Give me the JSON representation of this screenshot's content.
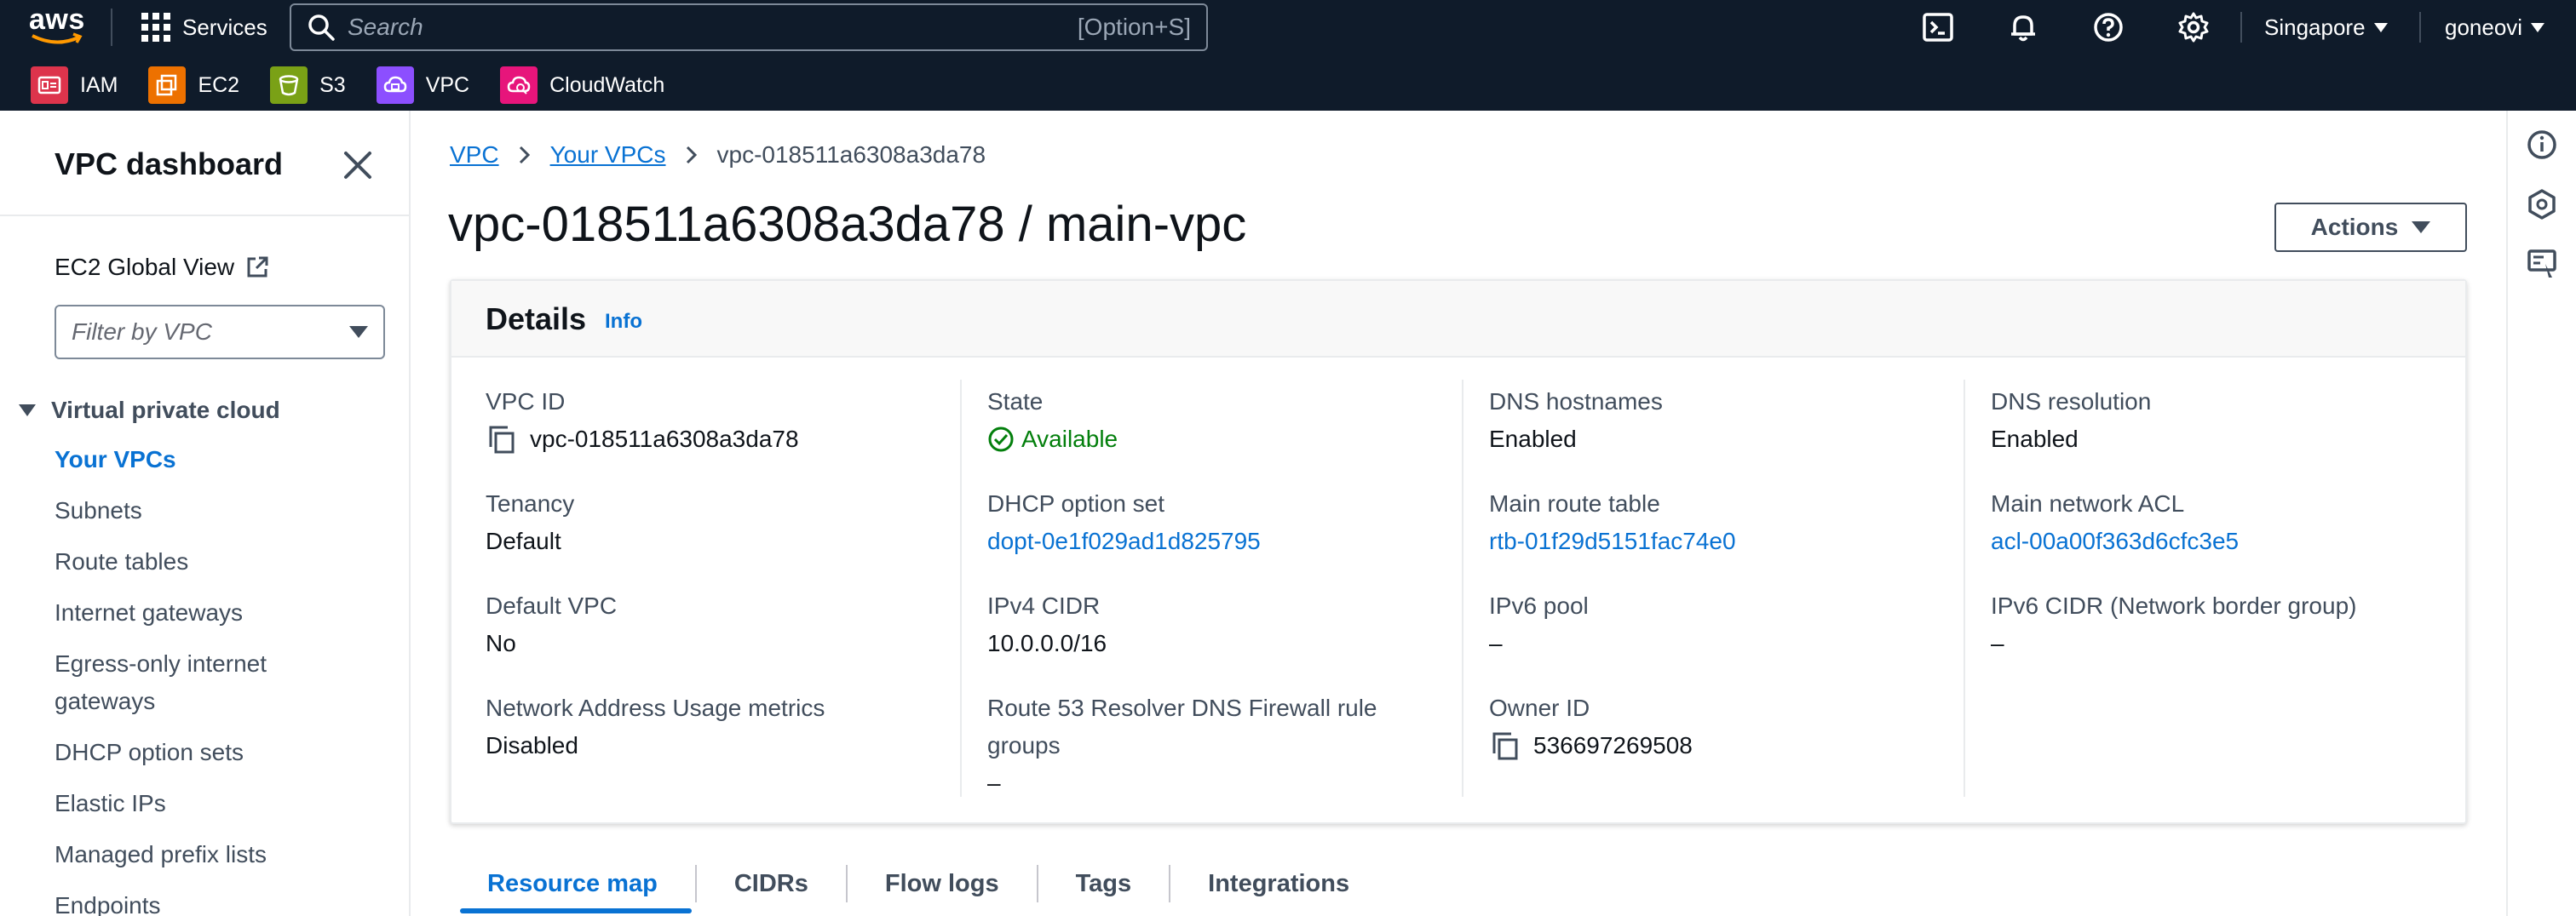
{
  "topnav": {
    "logo_text": "aws",
    "services_label": "Services",
    "search_placeholder": "Search",
    "search_shortcut": "[Option+S]",
    "region": "Singapore",
    "user": "goneovi"
  },
  "favorites": [
    {
      "label": "IAM",
      "color": "#dd344c"
    },
    {
      "label": "EC2",
      "color": "#ed7100"
    },
    {
      "label": "S3",
      "color": "#7aa116"
    },
    {
      "label": "VPC",
      "color": "#8c4fff"
    },
    {
      "label": "CloudWatch",
      "color": "#e7157b"
    }
  ],
  "sidebar": {
    "title": "VPC dashboard",
    "ec2_global_view": "EC2 Global View",
    "filter_placeholder": "Filter by VPC",
    "section": "Virtual private cloud",
    "items": [
      {
        "label": "Your VPCs",
        "active": true
      },
      {
        "label": "Subnets"
      },
      {
        "label": "Route tables"
      },
      {
        "label": "Internet gateways"
      },
      {
        "label": "Egress-only internet gateways"
      },
      {
        "label": "DHCP option sets"
      },
      {
        "label": "Elastic IPs"
      },
      {
        "label": "Managed prefix lists"
      },
      {
        "label": "Endpoints"
      }
    ]
  },
  "breadcrumb": {
    "items": [
      "VPC",
      "Your VPCs"
    ],
    "current": "vpc-018511a6308a3da78"
  },
  "page": {
    "title": "vpc-018511a6308a3da78 / main-vpc",
    "actions_label": "Actions"
  },
  "details": {
    "title": "Details",
    "info": "Info",
    "columns": [
      [
        {
          "key": "VPC ID",
          "value": "vpc-018511a6308a3da78",
          "copy": true
        },
        {
          "key": "Tenancy",
          "value": "Default"
        },
        {
          "key": "Default VPC",
          "value": "No"
        },
        {
          "key": "Network Address Usage metrics",
          "value": "Disabled"
        }
      ],
      [
        {
          "key": "State",
          "value": "Available",
          "status": "success"
        },
        {
          "key": "DHCP option set",
          "value": "dopt-0e1f029ad1d825795",
          "link": true
        },
        {
          "key": "IPv4 CIDR",
          "value": "10.0.0.0/16"
        },
        {
          "key": "Route 53 Resolver DNS Firewall rule groups",
          "value": "–"
        }
      ],
      [
        {
          "key": "DNS hostnames",
          "value": "Enabled"
        },
        {
          "key": "Main route table",
          "value": "rtb-01f29d5151fac74e0",
          "link": true
        },
        {
          "key": "IPv6 pool",
          "value": "–"
        },
        {
          "key": "Owner ID",
          "value": "536697269508",
          "copy": true
        }
      ],
      [
        {
          "key": "DNS resolution",
          "value": "Enabled"
        },
        {
          "key": "Main network ACL",
          "value": "acl-00a00f363d6cfc3e5",
          "link": true
        },
        {
          "key": "IPv6 CIDR (Network border group)",
          "value": "–"
        }
      ]
    ]
  },
  "tabs": [
    "Resource map",
    "CIDRs",
    "Flow logs",
    "Tags",
    "Integrations"
  ],
  "colors": {
    "nav_bg": "#0f1b2a",
    "link": "#0972d3",
    "success": "#037f0c"
  }
}
